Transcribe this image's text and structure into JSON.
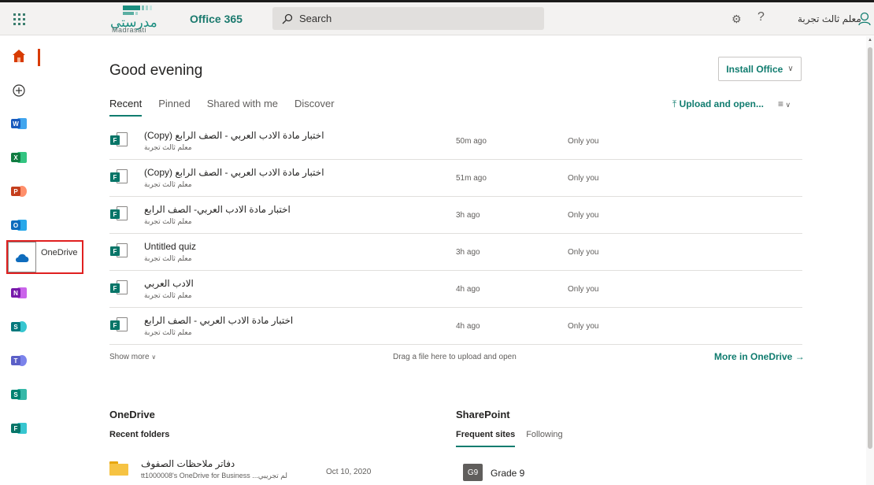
{
  "topbar": {
    "logo_arabic": "مدرستي",
    "logo_english": "Madrasati",
    "app_name": "Office 365",
    "search_placeholder": "Search",
    "user_name": "معلم ثالث تجربة"
  },
  "rail": {
    "tooltip": "OneDrive",
    "apps": [
      {
        "name": "Word",
        "letter": "W",
        "color": "#185abd"
      },
      {
        "name": "Excel",
        "letter": "X",
        "color": "#107c41"
      },
      {
        "name": "PowerPoint",
        "letter": "P",
        "color": "#c43e1c"
      },
      {
        "name": "Outlook",
        "letter": "O",
        "color": "#0f6cbd"
      },
      {
        "name": "OneNote",
        "letter": "N",
        "color": "#7719aa"
      },
      {
        "name": "SharePoint",
        "letter": "S",
        "color": "#03787c"
      },
      {
        "name": "Teams",
        "letter": "T",
        "color": "#5b5fc7"
      },
      {
        "name": "Sway",
        "letter": "S",
        "color": "#008272"
      },
      {
        "name": "Forms",
        "letter": "F",
        "color": "#077568"
      }
    ]
  },
  "main": {
    "greeting": "Good evening",
    "install_label": "Install Office",
    "tabs": [
      "Recent",
      "Pinned",
      "Shared with me",
      "Discover"
    ],
    "upload_label": "Upload and open...",
    "files": [
      {
        "name": "(Copy) اختبار مادة الادب العربي - الصف الرابع",
        "owner": "معلم ثالث تجربة",
        "time": "50m ago",
        "access": "Only you"
      },
      {
        "name": "(Copy) اختبار مادة الادب العربي - الصف الرابع",
        "owner": "معلم ثالث تجربة",
        "time": "51m ago",
        "access": "Only you"
      },
      {
        "name": "اختبار مادة الادب العربي- الصف الرابع",
        "owner": "معلم ثالث تجربة",
        "time": "3h ago",
        "access": "Only you"
      },
      {
        "name": "Untitled quiz",
        "owner": "معلم ثالث تجربة",
        "time": "3h ago",
        "access": "Only you"
      },
      {
        "name": "الادب العربي",
        "owner": "معلم ثالث تجربة",
        "time": "4h ago",
        "access": "Only you"
      },
      {
        "name": "اختبار مادة الادب العربي - الصف الرابع",
        "owner": "معلم ثالث تجربة",
        "time": "4h ago",
        "access": "Only you"
      }
    ],
    "show_more": "Show more",
    "drag_hint": "Drag a file here to upload and open",
    "more_onedrive": "More in OneDrive"
  },
  "onedrive": {
    "title": "OneDrive",
    "subtitle": "Recent folders",
    "folder_name": "دفاتر ملاحظات الصفوف",
    "folder_location": "tt1000008's OneDrive for Business ...لم تجريبي",
    "folder_date": "Oct 10, 2020"
  },
  "sharepoint": {
    "title": "SharePoint",
    "tabs": [
      "Frequent sites",
      "Following"
    ],
    "site_badge": "G9",
    "site_name": "Grade 9"
  }
}
